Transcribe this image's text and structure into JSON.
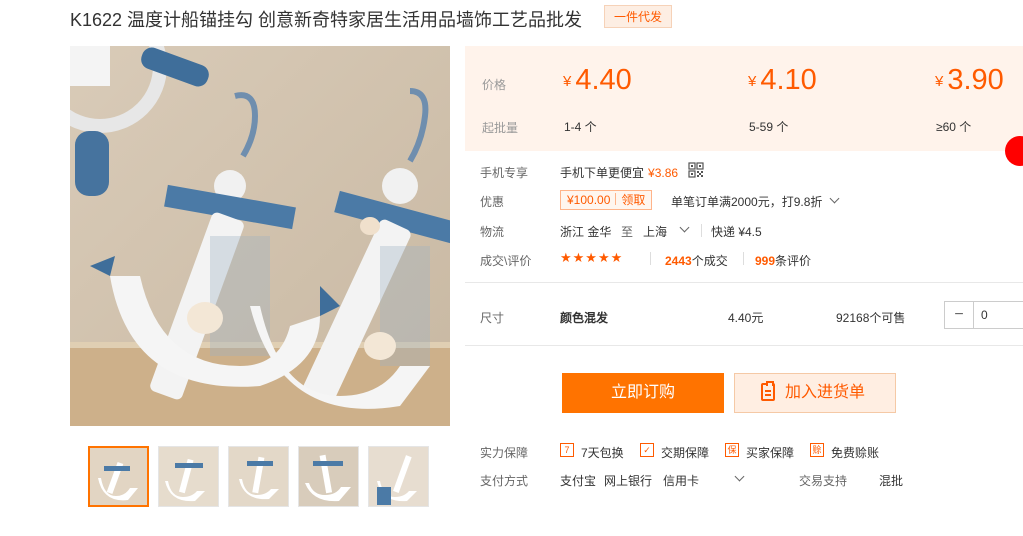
{
  "product": {
    "title": "K1622 温度计船锚挂勾 创意新奇特家居生活用品墙饰工艺品批发",
    "badge": "一件代发",
    "thumbnails": [
      "thumb-1",
      "thumb-2",
      "thumb-3",
      "thumb-4",
      "thumb-5"
    ]
  },
  "pricing": {
    "price_label": "价格",
    "moq_label": "起批量",
    "currency": "¥",
    "tiers": [
      {
        "price": "4.40",
        "range": "1-4 个"
      },
      {
        "price": "4.10",
        "range": "5-59 个"
      },
      {
        "price": "3.90",
        "range": "≥60 个"
      }
    ]
  },
  "info": {
    "mobile_label": "手机专享",
    "mobile_text": "手机下单更便宜",
    "mobile_price": "¥3.86",
    "promo_label": "优惠",
    "coupon_amount": "¥100.00",
    "coupon_action": "领取",
    "promo_text": "单笔订单满2000元，打9.8折",
    "logistics_label": "物流",
    "origin": "浙江 金华",
    "to_word": "至",
    "destination": "上海",
    "shipping": "快递 ¥4.5",
    "deals_label": "成交\\评价",
    "stars": "★★★★★",
    "deal_count": "2443",
    "deal_suffix": "个成交",
    "review_count": "999",
    "review_suffix": "条评价"
  },
  "sku": {
    "label": "尺寸",
    "name": "颜色混发",
    "price": "4.40元",
    "stock": "92168个可售",
    "minus": "−",
    "quantity": "0"
  },
  "actions": {
    "buy": "立即订购",
    "cart": "加入进货单"
  },
  "guarantee": {
    "label": "实力保障",
    "items": [
      {
        "icon": "7",
        "text": "7天包换"
      },
      {
        "icon": "✓",
        "text": "交期保障"
      },
      {
        "icon": "保",
        "text": "买家保障"
      },
      {
        "icon": "赊",
        "text": "免费赊账"
      }
    ]
  },
  "payment": {
    "label": "支付方式",
    "methods": [
      "支付宝",
      "网上银行",
      "信用卡"
    ],
    "trade_label": "交易支持",
    "trade_value": "混批"
  },
  "colors": {
    "accent": "#ff7300",
    "price": "#ff5a00",
    "price_panel": "#fff3eb"
  }
}
